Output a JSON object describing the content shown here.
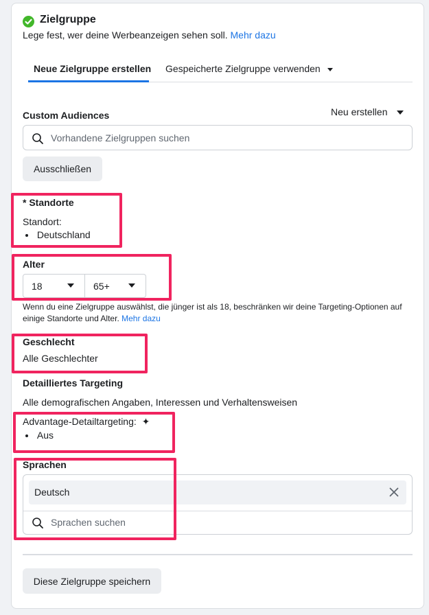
{
  "header": {
    "title": "Zielgruppe",
    "subtitle": "Lege fest, wer deine Werbeanzeigen sehen soll.",
    "more_link": "Mehr dazu"
  },
  "tabs": [
    {
      "label": "Neue Zielgruppe erstellen",
      "active": true
    },
    {
      "label": "Gespeicherte Zielgruppe verwenden",
      "active": false
    }
  ],
  "custom_audiences": {
    "label": "Custom Audiences",
    "create_new": "Neu erstellen",
    "search_placeholder": "Vorhandene Zielgruppen suchen",
    "exclude_button": "Ausschließen"
  },
  "locations": {
    "label": "* Standorte",
    "sub_label": "Standort:",
    "items": [
      "Deutschland"
    ]
  },
  "age": {
    "label": "Alter",
    "min": "18",
    "max": "65+",
    "note": "Wenn du eine Zielgruppe auswählst, die jünger ist als 18, beschränken wir deine Targeting-Optionen auf einige Standorte und Alter.",
    "note_link": "Mehr dazu"
  },
  "gender": {
    "label": "Geschlecht",
    "value": "Alle Geschlechter"
  },
  "detailed_targeting": {
    "label": "Detailliertes Targeting",
    "value": "Alle demografischen Angaben, Interessen und Verhaltensweisen",
    "advantage_label": "Advantage-Detailtargeting:",
    "advantage_items": [
      "Aus"
    ]
  },
  "languages": {
    "label": "Sprachen",
    "selected": "Deutsch",
    "search_placeholder": "Sprachen suchen"
  },
  "footer": {
    "save_button": "Diese Zielgruppe speichern"
  },
  "colors": {
    "accent": "#1b74e4",
    "highlight": "#f0245f",
    "success": "#42b72a"
  }
}
